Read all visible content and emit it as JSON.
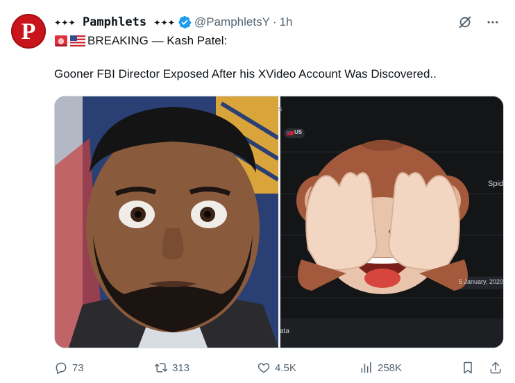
{
  "post": {
    "avatar_letter": "P",
    "display_name": "✦✦✦ Pamphlets ✦✦✦",
    "handle": "@PamphletsY",
    "separator": "·",
    "time": "1h",
    "line1": "BREAKING — Kash Patel:",
    "line2": "Gooner FBI Director Exposed After his XVideo Account Was Discovered..",
    "media": {
      "flag_label": "US",
      "right_partial_text": "Spid",
      "date_label": "5 January, 2020",
      "bottom_partial_text": "ata",
      "header_partial_text": "s"
    }
  },
  "actions": {
    "replies": "73",
    "reposts": "313",
    "likes": "4.5K",
    "views": "258K"
  },
  "colors": {
    "accent": "#1d9bf0",
    "muted": "#536471",
    "avatar_bg": "#c8141a"
  }
}
